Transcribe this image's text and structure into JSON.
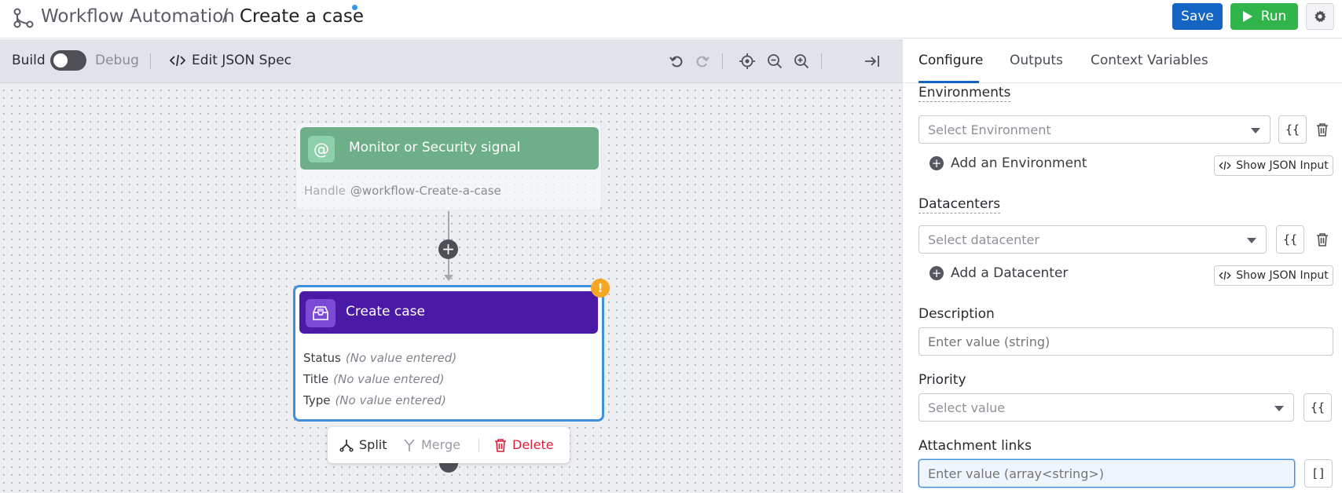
{
  "header": {
    "breadcrumb_parent": "Workflow Automation",
    "breadcrumb_separator": "/",
    "title": "Create a case",
    "save_label": "Save",
    "run_label": "Run",
    "colors": {
      "save": "#1464c4",
      "run": "#2fb54a",
      "unsaved_dot": "#3598ec"
    }
  },
  "toolbar": {
    "build_label": "Build",
    "debug_label": "Debug",
    "debug_enabled": false,
    "edit_json_label": "Edit JSON Spec",
    "icons": [
      "undo-icon",
      "redo-icon",
      "locate-icon",
      "zoom-out-icon",
      "zoom-in-icon",
      "collapse-panel-icon"
    ]
  },
  "canvas": {
    "trigger": {
      "icon": "at-sign-icon",
      "title": "Monitor or Security signal",
      "handle_label": "Handle",
      "handle_value": "@workflow-Create-a-case",
      "color": "#6eaf8a"
    },
    "add_step_symbol": "+",
    "action_node": {
      "icon": "case-inbox-icon",
      "title": "Create case",
      "color": "#4a1aa6",
      "warning_symbol": "!",
      "fields": [
        {
          "label": "Status",
          "value": "(No value entered)"
        },
        {
          "label": "Title",
          "value": "(No value entered)"
        },
        {
          "label": "Type",
          "value": "(No value entered)"
        }
      ]
    },
    "node_actions": {
      "split_label": "Split",
      "merge_label": "Merge",
      "delete_label": "Delete"
    }
  },
  "panel": {
    "tabs": [
      {
        "label": "Configure",
        "active": true
      },
      {
        "label": "Outputs",
        "active": false
      },
      {
        "label": "Context Variables",
        "active": false
      }
    ],
    "environments": {
      "label": "Environments",
      "placeholder": "Select Environment",
      "expression_symbol": "{{",
      "add_label": "Add an Environment",
      "json_label": "Show JSON Input"
    },
    "datacenters": {
      "label": "Datacenters",
      "placeholder": "Select datacenter",
      "expression_symbol": "{{",
      "add_label": "Add a Datacenter",
      "json_label": "Show JSON Input"
    },
    "description": {
      "label": "Description",
      "placeholder": "Enter value (string)"
    },
    "priority": {
      "label": "Priority",
      "placeholder": "Select value",
      "expression_symbol": "{{"
    },
    "attachment_links": {
      "label": "Attachment links",
      "placeholder": "Enter value (array<string>)",
      "array_symbol": "[]"
    }
  }
}
